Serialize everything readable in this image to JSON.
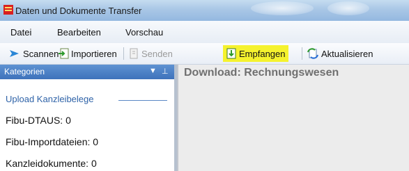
{
  "window": {
    "title": "Daten und Dokumente Transfer"
  },
  "menu": {
    "items": [
      "Datei",
      "Bearbeiten",
      "Vorschau"
    ]
  },
  "toolbar": {
    "buttons": [
      {
        "label": "Scannen",
        "icon": "scanner-arrow-icon",
        "enabled": true
      },
      {
        "label": "Importieren",
        "icon": "import-icon",
        "enabled": true
      },
      {
        "label": "Senden",
        "icon": "send-icon",
        "enabled": false
      },
      {
        "label": "Empfangen",
        "icon": "receive-icon",
        "enabled": true,
        "highlighted": true,
        "highlight_color": "#f5f22e"
      },
      {
        "label": "Aktualisieren",
        "icon": "refresh-icon",
        "enabled": true
      }
    ]
  },
  "sidebar": {
    "header": "Kategorien",
    "group_title": "Upload Kanzleibelege",
    "items": [
      "Fibu-DTAUS: 0",
      "Fibu-Importdateien: 0",
      "Kanzleidokumente: 0"
    ]
  },
  "main": {
    "title": "Download: Rechnungswesen"
  },
  "colors": {
    "accent": "#3e72bb",
    "group_title": "#2f63a8",
    "highlight": "#f5f22e"
  }
}
